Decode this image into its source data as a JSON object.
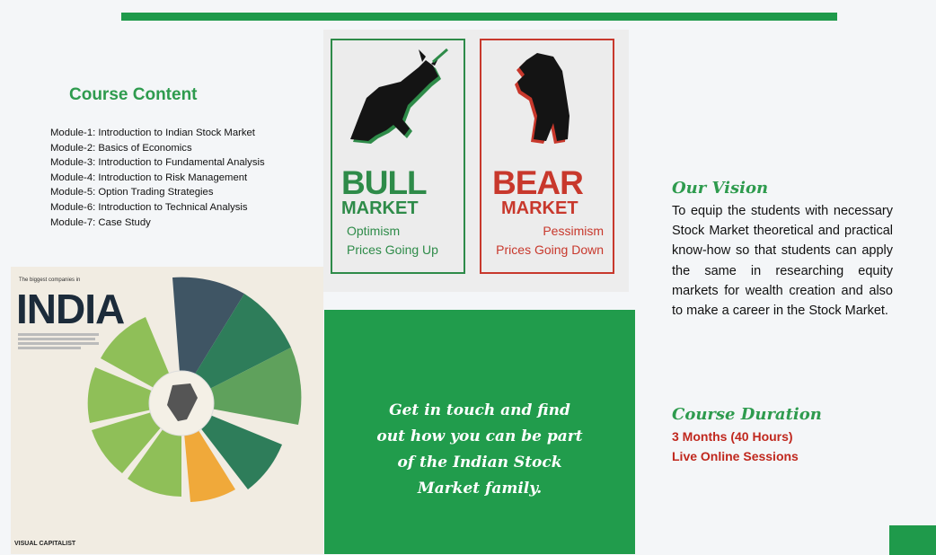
{
  "course_content": {
    "title": "Course Content",
    "modules": [
      "Module-1: Introduction to Indian Stock Market",
      "Module-2: Basics of Economics",
      "Module-3: Introduction to Fundamental Analysis",
      "Module-4: Introduction to Risk Management",
      "Module-5: Option Trading Strategies",
      "Module-6: Introduction to Technical Analysis",
      "Module-7: Case Study"
    ]
  },
  "bull_card": {
    "word": "BULL",
    "market": "MARKET",
    "line1": "Optimism",
    "line2": "Prices Going Up",
    "color": "#2e8b49"
  },
  "bear_card": {
    "word": "BEAR",
    "market": "MARKET",
    "line1": "Pessimism",
    "line2": "Prices Going Down",
    "color": "#c8382c"
  },
  "infographic": {
    "small_title": "The biggest companies in",
    "title": "INDIA",
    "footer": "VISUAL CAPITALIST",
    "segment_colors": [
      "#3f5564",
      "#2e7d5a",
      "#5fa15c",
      "#8fbf58",
      "#f0a93a"
    ]
  },
  "cta": {
    "lines": [
      "Get in touch and find",
      "out how you can be part",
      "of the Indian Stock",
      "Market family."
    ]
  },
  "vision": {
    "title": "Our Vision",
    "text": "To equip the students with necessary Stock Market theoretical and practical know-how so that students can apply the same in researching equity markets for wealth creation and also to make a career in the Stock Market."
  },
  "duration": {
    "title": "Course Duration",
    "line1": "3 Months (40 Hours)",
    "line2": "Live Online Sessions"
  },
  "colors": {
    "accent_green": "#1f9a4b",
    "accent_red": "#c0281e"
  }
}
